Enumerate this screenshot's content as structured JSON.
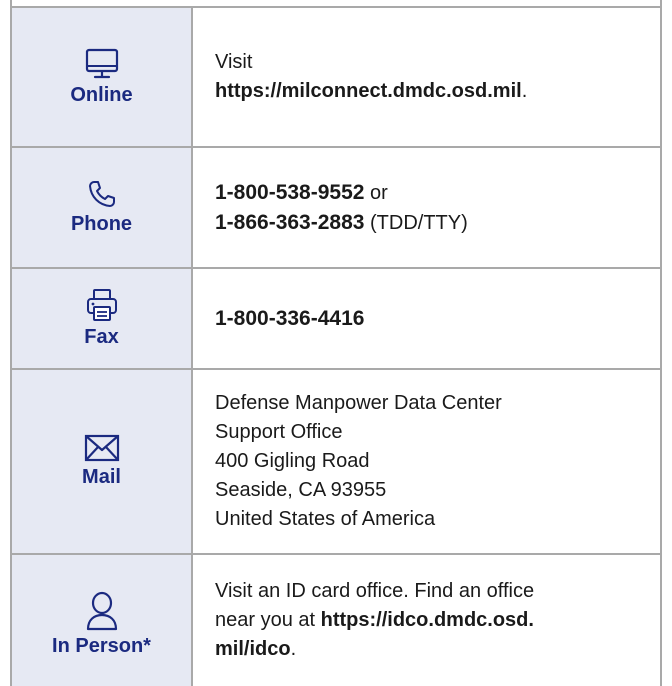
{
  "rows": {
    "online": {
      "icon": "monitor-icon",
      "label": "Online",
      "line1": "Visit",
      "url": "https://milconnect.dmdc.osd.mil",
      "url_end": "."
    },
    "phone": {
      "icon": "phone-icon",
      "label": "Phone",
      "number1": "1-800-538-9552",
      "number1_suffix": " or",
      "number2": "1-866-363-2883",
      "number2_suffix": " (TDD/TTY)"
    },
    "fax": {
      "icon": "printer-icon",
      "label": "Fax",
      "number": "1-800-336-4416"
    },
    "mail": {
      "icon": "envelope-icon",
      "label": "Mail",
      "address": [
        "Defense Manpower Data Center",
        "Support Office",
        "400 Gigling Road",
        "Seaside, CA 93955",
        "United States of America"
      ]
    },
    "in_person": {
      "icon": "person-icon",
      "label": "In Person*",
      "text1": "Visit an ID card office. Find an office",
      "text2": "near you at ",
      "url1": "https://idco.dmdc.osd.",
      "url2": "mil/idco",
      "url_end": "."
    }
  },
  "colors": {
    "label_bg": "#e6e9f3",
    "label_text": "#1b2a80",
    "border": "#a9a9a9"
  }
}
